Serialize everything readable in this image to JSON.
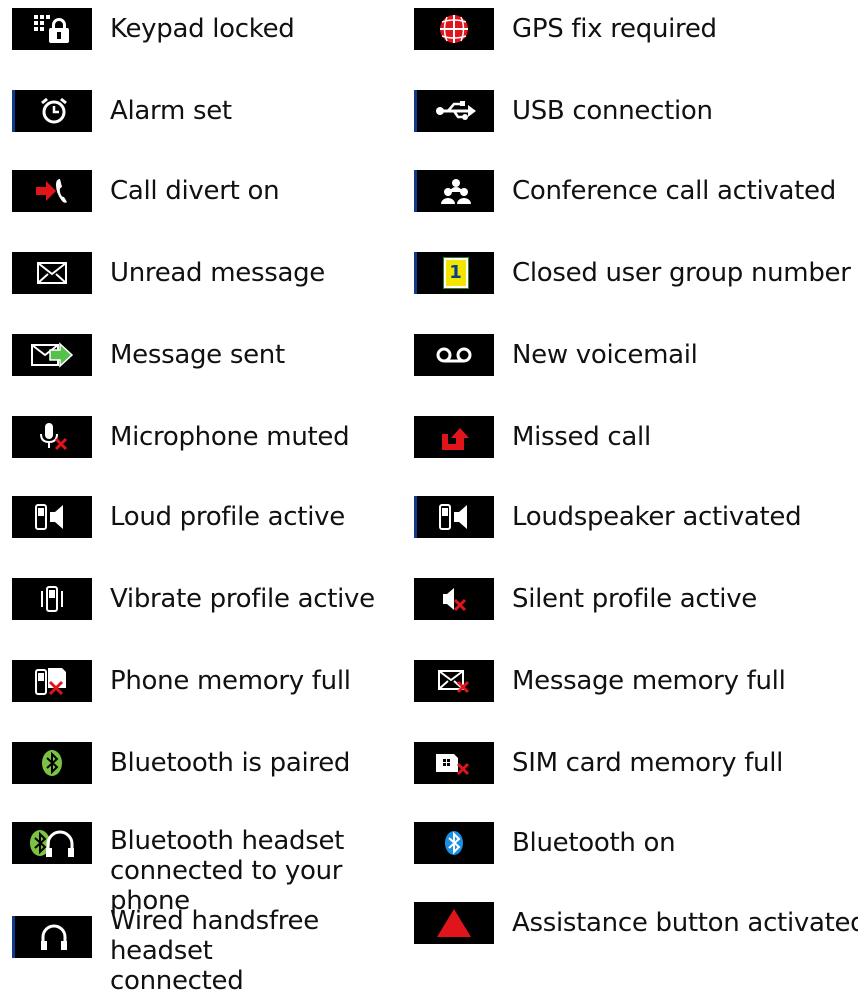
{
  "left_column": [
    {
      "label": "Keypad locked",
      "icon": "keypad-lock-icon"
    },
    {
      "label": "Alarm set",
      "icon": "alarm-clock-icon"
    },
    {
      "label": "Call divert on",
      "icon": "call-divert-icon"
    },
    {
      "label": "Unread message",
      "icon": "envelope-icon"
    },
    {
      "label": "Message sent",
      "icon": "message-sent-icon"
    },
    {
      "label": "Microphone muted",
      "icon": "microphone-muted-icon"
    },
    {
      "label": "Loud profile active",
      "icon": "loud-profile-icon"
    },
    {
      "label": "Vibrate profile active",
      "icon": "vibrate-profile-icon"
    },
    {
      "label": "Phone memory full",
      "icon": "phone-memory-full-icon"
    },
    {
      "label": "Bluetooth is paired",
      "icon": "bluetooth-paired-icon"
    },
    {
      "label": "Bluetooth headset connected to your phone",
      "icon": "bluetooth-headset-icon"
    },
    {
      "label": "Wired handsfree headset connected",
      "icon": "wired-headset-icon"
    }
  ],
  "right_column": [
    {
      "label": "GPS fix required",
      "icon": "gps-icon"
    },
    {
      "label": "USB connection",
      "icon": "usb-icon"
    },
    {
      "label": "Conference call activated",
      "icon": "conference-call-icon"
    },
    {
      "label": "Closed user group number",
      "icon": "closed-user-group-icon",
      "badge": "1"
    },
    {
      "label": "New voicemail",
      "icon": "voicemail-icon"
    },
    {
      "label": "Missed call",
      "icon": "missed-call-icon"
    },
    {
      "label": "Loudspeaker activated",
      "icon": "loudspeaker-icon"
    },
    {
      "label": "Silent profile active",
      "icon": "silent-profile-icon"
    },
    {
      "label": "Message memory full",
      "icon": "message-memory-full-icon"
    },
    {
      "label": "SIM card memory full",
      "icon": "sim-memory-full-icon"
    },
    {
      "label": "Bluetooth on",
      "icon": "bluetooth-on-icon"
    },
    {
      "label": "Assistance button activated",
      "icon": "assistance-triangle-icon"
    }
  ],
  "colors": {
    "icon_bg": "#000000",
    "accent_red": "#e0141b",
    "bluetooth_green": "#7cc242",
    "bluetooth_blue": "#1a8fe3",
    "badge_yellow": "#f2e600",
    "left_edge_blue": "#0f3b8a"
  }
}
